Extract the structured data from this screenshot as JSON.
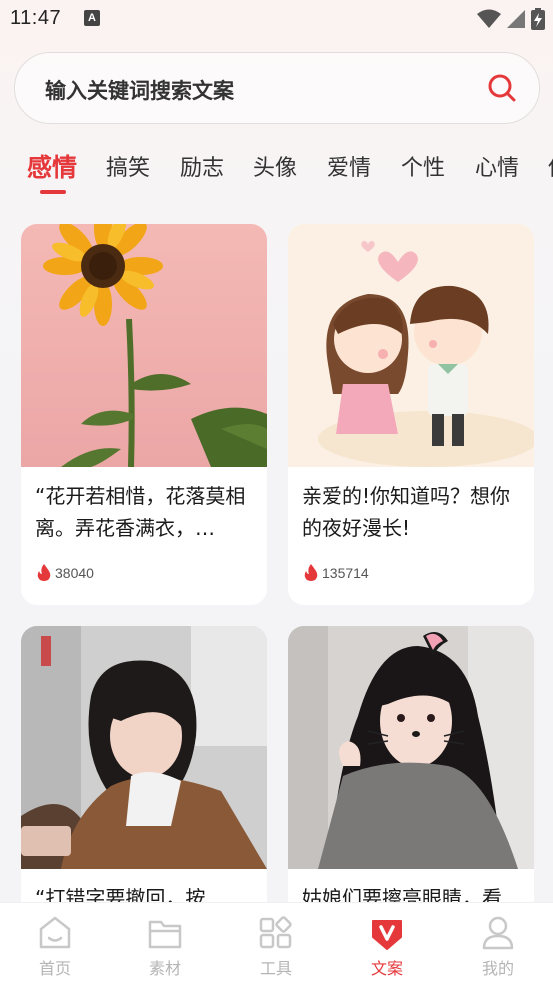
{
  "status_bar": {
    "time": "11:47",
    "notification_glyph": "A",
    "icons": [
      "wifi-icon",
      "signal-icon",
      "battery-charging-icon"
    ]
  },
  "search": {
    "placeholder": "输入关键词搜索文案",
    "icon": "search-icon",
    "accent": "#e5383b"
  },
  "tabs": [
    {
      "label": "感情",
      "active": true
    },
    {
      "label": "搞笑",
      "active": false
    },
    {
      "label": "励志",
      "active": false
    },
    {
      "label": "头像",
      "active": false
    },
    {
      "label": "爱情",
      "active": false
    },
    {
      "label": "个性",
      "active": false
    },
    {
      "label": "心情",
      "active": false
    },
    {
      "label": "伤",
      "active": false
    }
  ],
  "cards": [
    {
      "text": "“花开若相惜，花落莫相离。弄花香满衣，…",
      "likes": "38040",
      "image": "sunflower-photo"
    },
    {
      "text": "亲爱的!你知道吗？想你的夜好漫长!",
      "likes": "135714",
      "image": "cartoon-couple-kiss-illustration"
    },
    {
      "text": "“打错字要撤回，按",
      "likes": "",
      "image": "girl-with-phone-photo"
    },
    {
      "text": "姑娘们要擦亮眼睛，看",
      "likes": "",
      "image": "girl-cat-filter-photo"
    }
  ],
  "bottom_nav": [
    {
      "label": "首页",
      "icon": "home-icon",
      "active": false
    },
    {
      "label": "素材",
      "icon": "folder-icon",
      "active": false
    },
    {
      "label": "工具",
      "icon": "tools-grid-icon",
      "active": false
    },
    {
      "label": "文案",
      "icon": "wenan-v-icon",
      "active": true
    },
    {
      "label": "我的",
      "icon": "profile-icon",
      "active": false
    }
  ],
  "colors": {
    "accent": "#e5383b",
    "inactive_nav": "#b5b5b5",
    "background": "#f4f4f6"
  }
}
